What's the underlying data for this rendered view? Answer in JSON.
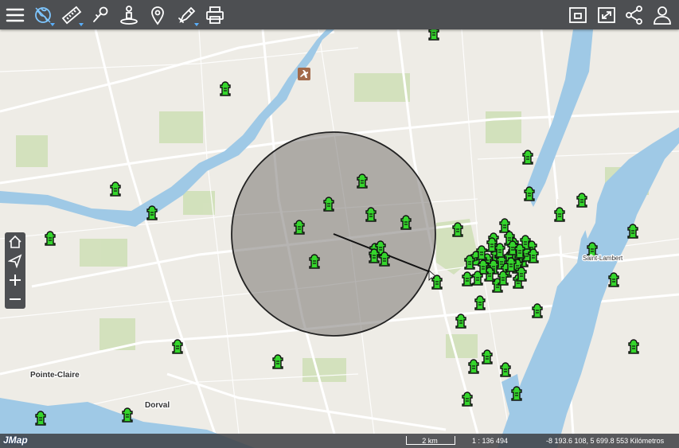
{
  "app": {
    "logo": "JMap"
  },
  "toolbar": {
    "left": [
      {
        "icon": "menu-icon",
        "label": "Menu"
      },
      {
        "icon": "layers-globe-icon",
        "label": "Layers",
        "active": true,
        "has_menu": true
      },
      {
        "icon": "ruler-icon",
        "label": "Measure",
        "has_menu": true
      },
      {
        "icon": "pin-select-icon",
        "label": "Select"
      },
      {
        "icon": "person-location-icon",
        "label": "Locate"
      },
      {
        "icon": "map-marker-icon",
        "label": "Marker"
      },
      {
        "icon": "draw-pencil-icon",
        "label": "Draw",
        "has_menu": true
      },
      {
        "icon": "printer-icon",
        "label": "Print"
      }
    ],
    "right": [
      {
        "icon": "window-icon",
        "label": "Window"
      },
      {
        "icon": "fullscreen-icon",
        "label": "Fullscreen"
      },
      {
        "icon": "share-icon",
        "label": "Share"
      },
      {
        "icon": "user-icon",
        "label": "User"
      }
    ]
  },
  "navigation": [
    {
      "icon": "home-icon",
      "label": "Home"
    },
    {
      "icon": "navigate-arrow-icon",
      "label": "Navigate"
    },
    {
      "icon": "zoom-in-icon",
      "label": "Zoom in"
    },
    {
      "icon": "zoom-out-icon",
      "label": "Zoom out"
    }
  ],
  "map": {
    "colors": {
      "land": "#eeece6",
      "water": "#9fc9e6",
      "park": "#cfe0b8",
      "road": "#ffffff",
      "buffer_fill": "#6d6a66",
      "marker": "#35d62c"
    },
    "places": [
      {
        "name": "Pointe-Claire",
        "kind": "city"
      },
      {
        "name": "Dorval",
        "kind": "city"
      },
      {
        "name": "Saint-Lambert",
        "kind": "town"
      }
    ],
    "poi": [
      {
        "icon": "airport-icon",
        "label": "Airport"
      }
    ],
    "marker_icon": "hydrant-icon",
    "marker_count": 70
  },
  "status": {
    "scale_label": "2 km",
    "ratio": "1 : 136 494",
    "coordinates": "-8 193.6 108, 5 699.8 553 Kilómetros"
  }
}
